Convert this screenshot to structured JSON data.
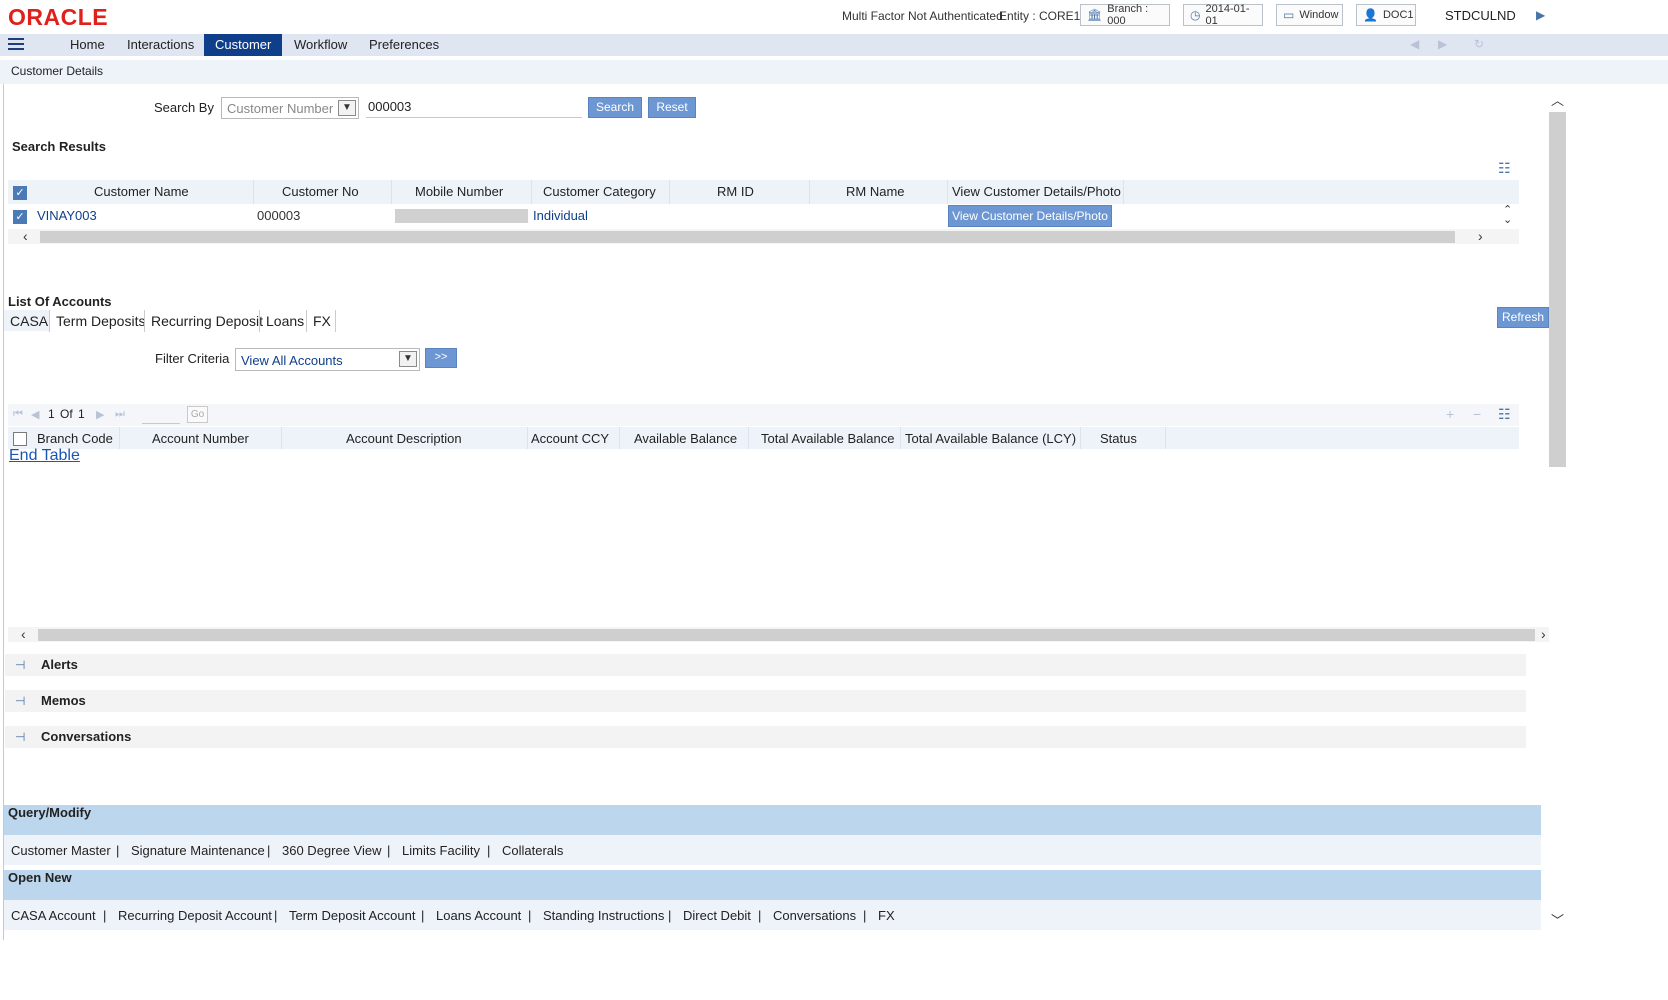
{
  "header": {
    "logo": "ORACLE",
    "mfa_status": "Multi Factor Not Authenticated",
    "entity": "Entity : CORE1",
    "branch": "Branch : 000",
    "date": "2014-01-01",
    "window": "Window",
    "user": "DOC1",
    "user_code": "STDCULND"
  },
  "menu": {
    "items": [
      "Home",
      "Interactions",
      "Customer",
      "Workflow",
      "Preferences"
    ],
    "active": "Customer"
  },
  "page": {
    "title": "Customer Details"
  },
  "search": {
    "label": "Search By",
    "select_value": "Customer Number",
    "input_value": "000003",
    "search_label": "Search",
    "reset_label": "Reset"
  },
  "results": {
    "title": "Search Results",
    "columns": [
      "Customer Name",
      "Customer No",
      "Mobile Number",
      "Customer Category",
      "RM ID",
      "RM Name",
      "View Customer Details/Photo"
    ],
    "rows": [
      {
        "name": "VINAY003",
        "number": "000003",
        "mobile": "",
        "category": "Individual",
        "rm_id": "",
        "rm_name": "",
        "action": "View Customer Details/Photo"
      }
    ]
  },
  "accounts": {
    "title": "List Of Accounts",
    "tabs": [
      "CASA",
      "Term Deposits",
      "Recurring Deposit",
      "Loans",
      "FX"
    ],
    "active_tab": "CASA",
    "refresh_label": "Refresh",
    "filter_label": "Filter Criteria",
    "filter_value": "View All Accounts",
    "go_arrow": ">>",
    "pager": {
      "current": "1",
      "of_label": "Of",
      "total": "1",
      "go_label": "Go"
    },
    "columns": [
      "Branch Code",
      "Account Number",
      "Account Description",
      "Account CCY",
      "Available Balance",
      "Total Available Balance",
      "Total Available Balance (LCY)",
      "Status"
    ],
    "end_table": "End Table"
  },
  "sections": [
    "Alerts",
    "Memos",
    "Conversations"
  ],
  "query_modify": {
    "title": "Query/Modify",
    "links": [
      "Customer Master",
      "Signature Maintenance",
      "360 Degree View",
      "Limits Facility",
      "Collaterals"
    ]
  },
  "open_new": {
    "title": "Open New",
    "links": [
      "CASA Account",
      "Recurring Deposit Account",
      "Term Deposit Account",
      "Loans Account",
      "Standing Instructions",
      "Direct Debit",
      "Conversations",
      "FX"
    ]
  },
  "colors": {
    "brand": "#e0201b",
    "menu_active": "#0f3f8b",
    "button": "#6d97d2",
    "band": "#bcd6ee"
  }
}
